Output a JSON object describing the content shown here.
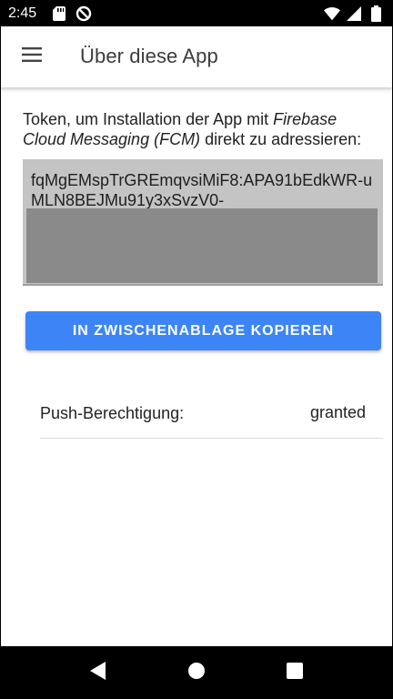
{
  "status_bar": {
    "time": "2:45",
    "left_icons": [
      "sd-card-icon",
      "data-saver-icon"
    ],
    "right_icons": [
      "wifi-icon",
      "cellular-signal-icon",
      "battery-icon"
    ]
  },
  "app_bar": {
    "title": "Über diese App",
    "menu_icon": "hamburger-menu-icon"
  },
  "content": {
    "description": {
      "part1": "Token, um Installation der App mit ",
      "italic1": "Firebase Cloud Messaging (FCM)",
      "part2": " direkt zu adressieren:"
    },
    "token": {
      "visible_text": "fqMgEMspTrGREmqvsiMiF8:APA91bEdkWR-uMLN8BEJMu91y3xSvzV0-"
    },
    "copy_button_label": "IN ZWISCHENABLAGE KOPIEREN",
    "push_permission": {
      "label": "Push-Berechtigung:",
      "value": "granted"
    }
  },
  "colors": {
    "primary": "#3d85f6",
    "token_background": "#c4c4c4",
    "redaction": "#8a8a8a"
  },
  "nav_bar": {
    "buttons": [
      "back-icon",
      "home-icon",
      "recents-icon"
    ]
  }
}
